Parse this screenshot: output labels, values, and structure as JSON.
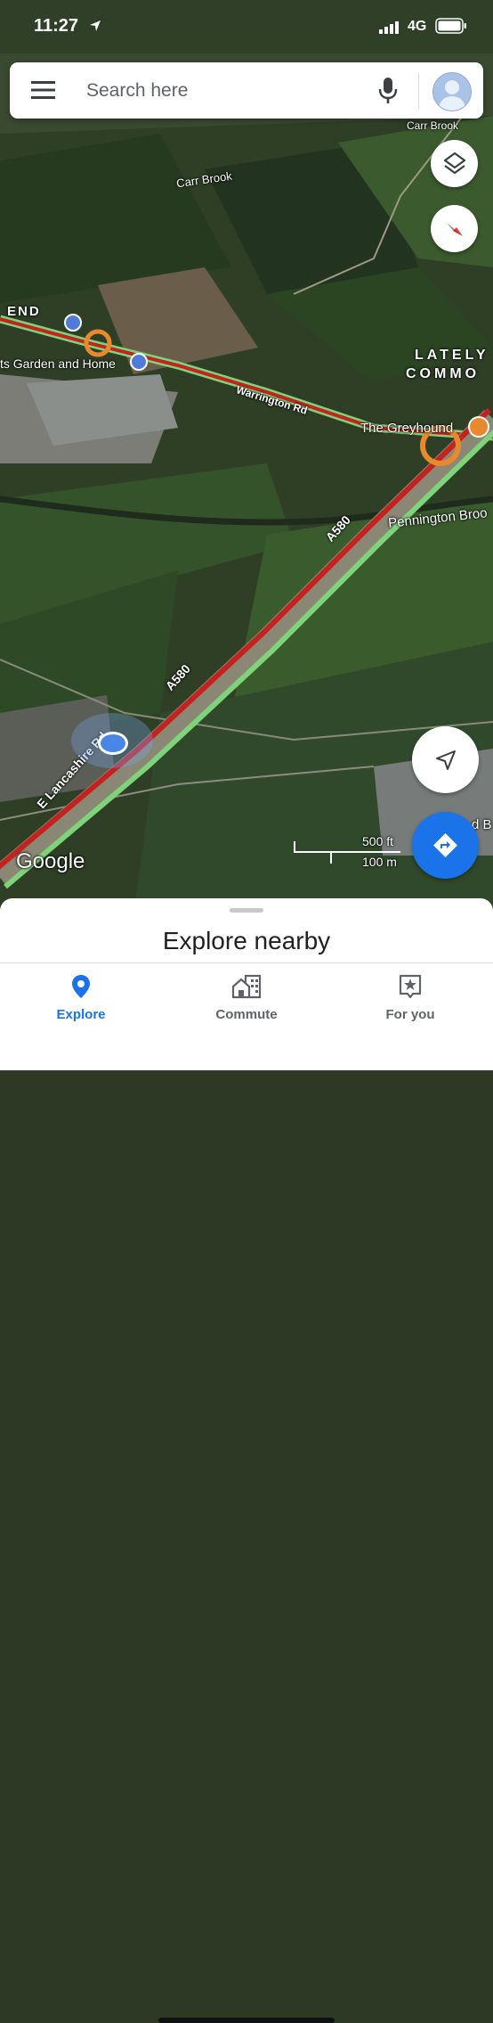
{
  "status_bar": {
    "time": "11:27",
    "network": "4G"
  },
  "search": {
    "placeholder": "Search here"
  },
  "map": {
    "labels": {
      "carr_brook_top": "Carr Brook",
      "carr_brook": "Carr Brook",
      "end_fragment": "END",
      "garden_centre": "ts Garden and Home",
      "lately_common_1": "LATELY",
      "lately_common_2": "COMMO",
      "warrington_rd": "Warrington Rd",
      "greyhound": "The Greyhound",
      "pennington": "Pennington Broo",
      "a580_upper": "A580",
      "a580_lower": "A580",
      "e_lancashire_rd": "E Lancashire Rd",
      "right_edge_fragment": "d B",
      "google_logo": "Google"
    },
    "scale": {
      "imperial": "500 ft",
      "metric": "100 m"
    }
  },
  "bottom_sheet": {
    "title": "Explore nearby"
  },
  "tabs": [
    {
      "label": "Explore",
      "active": true,
      "icon": "pin-icon"
    },
    {
      "label": "Commute",
      "active": false,
      "icon": "commute-icon"
    },
    {
      "label": "For you",
      "active": false,
      "icon": "for-you-icon"
    }
  ],
  "colors": {
    "accent": "#1a73e8",
    "traffic_red": "#c5221f",
    "traffic_green": "#7fd37a"
  }
}
